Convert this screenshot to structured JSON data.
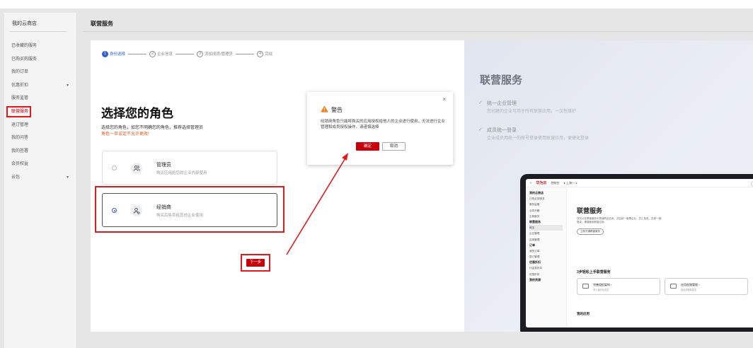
{
  "sidebar": {
    "title": "我的云商店",
    "items": [
      {
        "label": "已收藏的服务",
        "chevron": false
      },
      {
        "label": "已购买的服务",
        "chevron": false
      },
      {
        "label": "我的订单",
        "chevron": false
      },
      {
        "label": "优惠折扣",
        "chevron": true
      },
      {
        "label": "服务监管",
        "chevron": false
      },
      {
        "label": "联营服务",
        "chevron": false,
        "active": true
      },
      {
        "label": "退订管理",
        "chevron": false
      },
      {
        "label": "我的问答",
        "chevron": false
      },
      {
        "label": "我的签署",
        "chevron": false
      },
      {
        "label": "会员权益",
        "chevron": false
      },
      {
        "label": "云包",
        "chevron": true
      }
    ]
  },
  "main": {
    "title": "联营服务"
  },
  "stepper": {
    "steps": [
      {
        "num": "1",
        "label": "身份选择"
      },
      {
        "num": "2",
        "label": "企业信息"
      },
      {
        "num": "3",
        "label": "添加成员/管理员"
      },
      {
        "num": "4",
        "label": "完成"
      }
    ]
  },
  "role": {
    "title": "选择您的角色",
    "desc": "选择您的角色，如您不明确您的角色，推荐选择管理员",
    "warning": "角色一旦设定不允许更改!",
    "options": [
      {
        "name": "管理员",
        "sub": "购买应用给您的企业内部使用",
        "selected": false
      },
      {
        "name": "经销商",
        "sub": "购买后售卖给其他企业使用",
        "selected": true
      }
    ],
    "next_label": "下一步"
  },
  "promo": {
    "title": "联营服务",
    "features": [
      {
        "title": "统一企业管理",
        "desc": "您创建的企业可用于所有联营应用，一次性维护"
      },
      {
        "title": "成员统一登录",
        "desc": "企业成员用统一的账号登录使用联营应用，便捷化登录"
      }
    ],
    "screen": {
      "brand": "华为云",
      "top_a": "控制台",
      "top_b": "● 上海一 ∨",
      "side": [
        {
          "label": "我的云商店",
          "h": true
        },
        {
          "label": "已购买的服务"
        },
        {
          "label": "服务监管"
        },
        {
          "label": "合同书籍"
        },
        {
          "label": "生鲜服务"
        },
        {
          "label": "联营服务",
          "h": true
        },
        {
          "label": "概览",
          "sel": true
        },
        {
          "label": "企业管理"
        },
        {
          "label": "应用管理"
        },
        {
          "label": "订单",
          "h": true
        },
        {
          "label": "我的订单"
        },
        {
          "label": "退订管理"
        },
        {
          "label": "优惠折扣",
          "h": true
        },
        {
          "label": "代金券折扣"
        },
        {
          "label": "优惠折扣"
        },
        {
          "label": "我的资源",
          "h": true
        }
      ],
      "title": "联营服务",
      "desc": "您可以在联营服务中快速购买应用，并且统一管理企业、员工信息，实现一键登录，便捷使用联营应用。",
      "button": "立即开通联营服务",
      "steps_title": "3步轻松上手联营服务",
      "card1_title": "完善组织架构 ›",
      "card1_sub": "导入组织及成员",
      "card2_title": "应用权限管理 ›",
      "card2_sub": "给应用授权成员",
      "apps_title": "我的应用"
    }
  },
  "dialog": {
    "title": "警告",
    "body": "经销商角色只能将购买的应用授权给他人的企业进行使用，无法进行企业管理和成员授权操作，请谨慎选择",
    "ok": "确定",
    "cancel": "取消"
  },
  "colors": {
    "accent": "#c7000b",
    "highlight": "#e0191d",
    "primary": "#2d5fdc",
    "warning": "#e0551b"
  }
}
